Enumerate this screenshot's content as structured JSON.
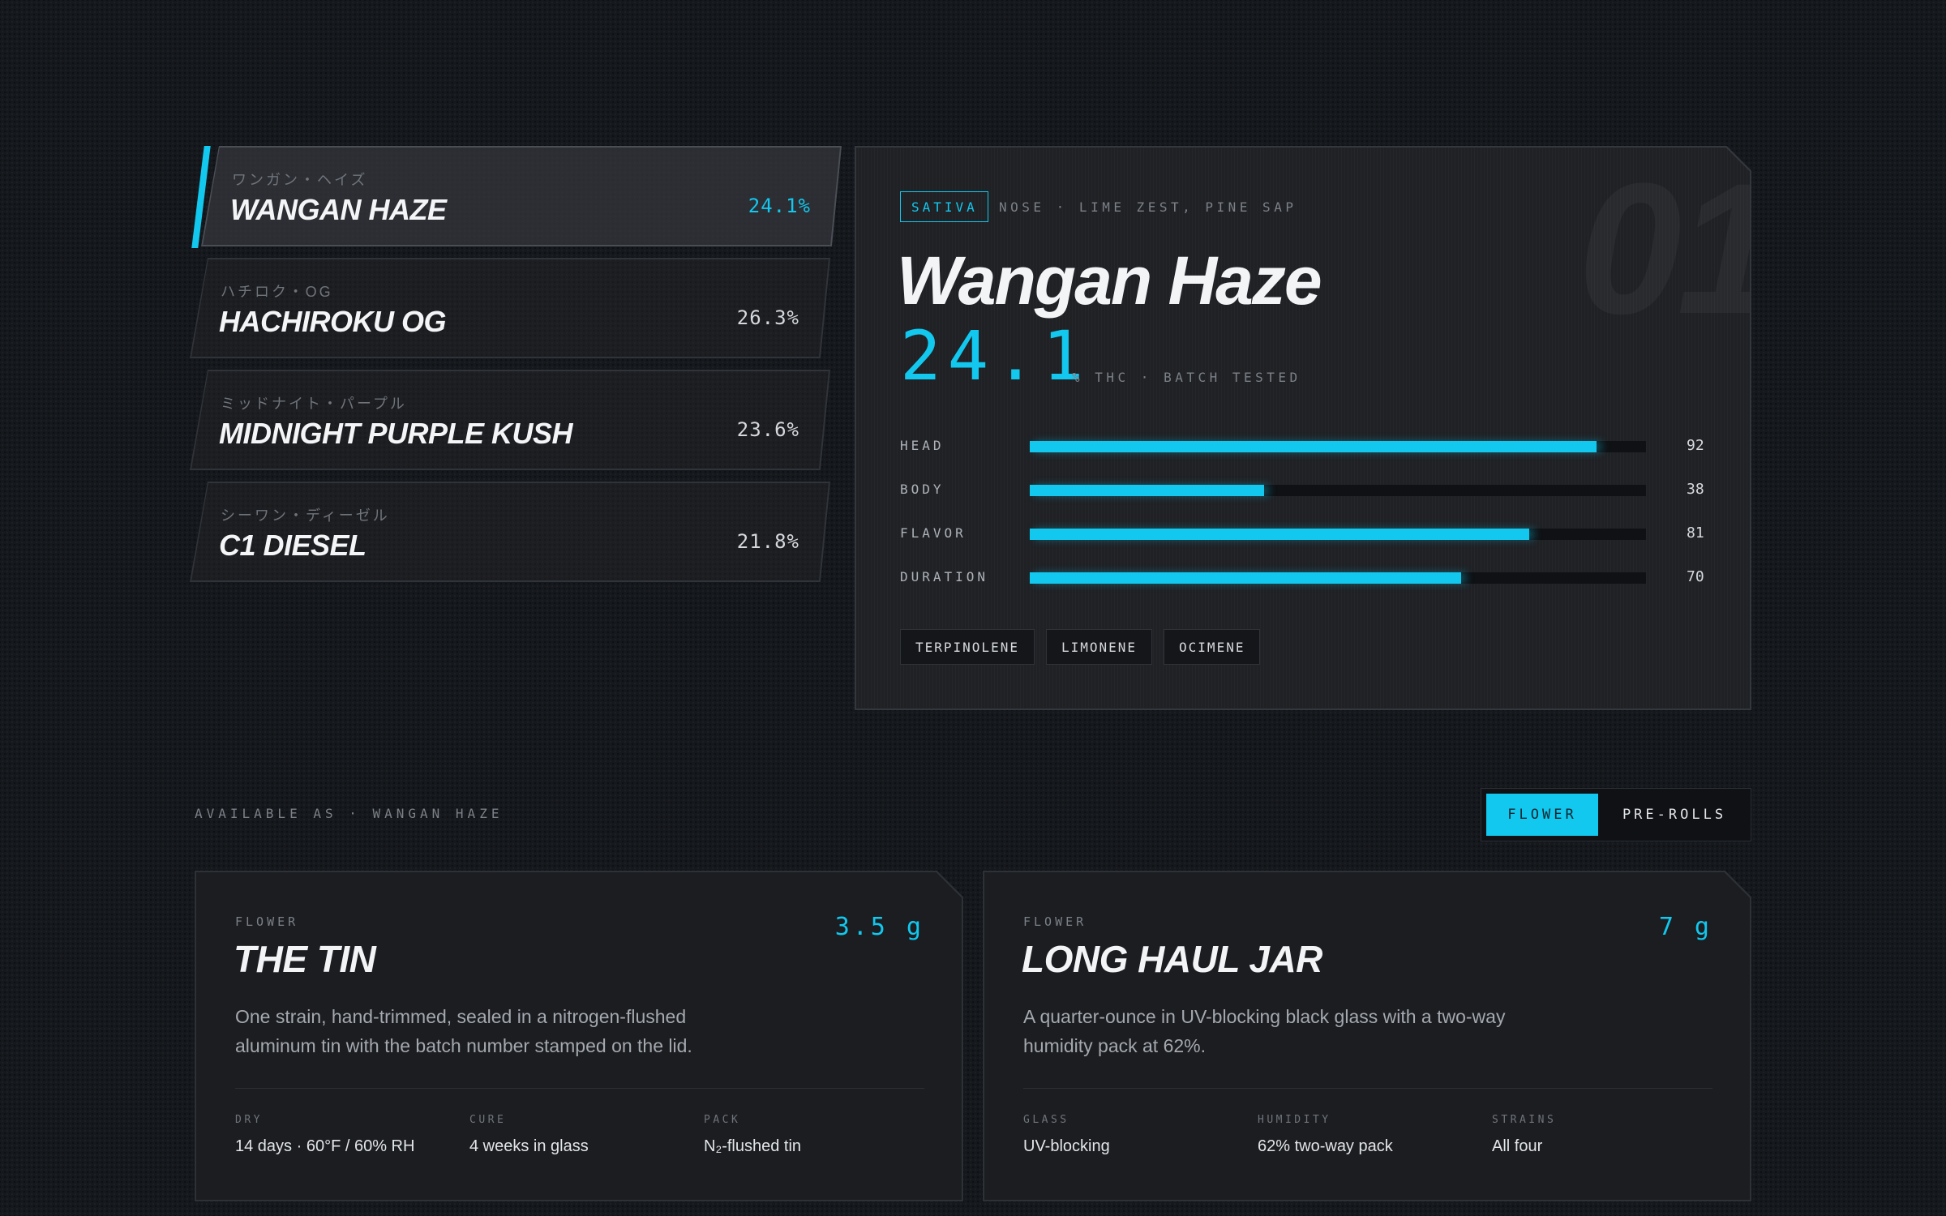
{
  "strains": [
    {
      "jp": "ワンガン・ヘイズ",
      "name": "WANGAN HAZE",
      "pct": "24.1%",
      "active": true
    },
    {
      "jp": "ハチロク・OG",
      "name": "HACHIROKU OG",
      "pct": "26.3%",
      "active": false
    },
    {
      "jp": "ミッドナイト・パープル",
      "name": "MIDNIGHT PURPLE KUSH",
      "pct": "23.6%",
      "active": false
    },
    {
      "jp": "シーワン・ディーゼル",
      "name": "C1 DIESEL",
      "pct": "21.8%",
      "active": false
    }
  ],
  "detail": {
    "watermark": "01",
    "type": "SATIVA",
    "nose": "NOSE · LIME ZEST, PINE SAP",
    "title": "Wangan Haze",
    "thc": "24.1",
    "thc_sub": "% THC · BATCH TESTED",
    "stats": [
      {
        "label": "HEAD",
        "value": 92
      },
      {
        "label": "BODY",
        "value": 38
      },
      {
        "label": "FLAVOR",
        "value": 81
      },
      {
        "label": "DURATION",
        "value": 70
      }
    ],
    "terpenes": [
      "TERPINOLENE",
      "LIMONENE",
      "OCIMENE"
    ]
  },
  "available": {
    "label": "AVAILABLE AS · WANGAN HAZE",
    "toggle": {
      "selected": "FLOWER",
      "other": "PRE-ROLLS"
    }
  },
  "cards": [
    {
      "category": "FLOWER",
      "size": "3.5 g",
      "title": "THE TIN",
      "description": "One strain, hand-trimmed, sealed in a nitrogen-flushed aluminum tin with the batch number stamped on the lid.",
      "specs": [
        {
          "key": "DRY",
          "value": "14 days · 60°F / 60% RH"
        },
        {
          "key": "CURE",
          "value": "4 weeks in glass"
        },
        {
          "key": "PACK",
          "value": "N₂-flushed tin"
        }
      ]
    },
    {
      "category": "FLOWER",
      "size": "7 g",
      "title": "LONG HAUL JAR",
      "description": "A quarter-ounce in UV-blocking black glass with a two-way humidity pack at 62%.",
      "specs": [
        {
          "key": "GLASS",
          "value": "UV-blocking"
        },
        {
          "key": "HUMIDITY",
          "value": "62% two-way pack"
        },
        {
          "key": "STRAINS",
          "value": "All four"
        }
      ]
    }
  ],
  "colors": {
    "accent": "#12c8ee",
    "background": "#15181c",
    "panel": "#1f2125",
    "card": "#1b1d21"
  }
}
